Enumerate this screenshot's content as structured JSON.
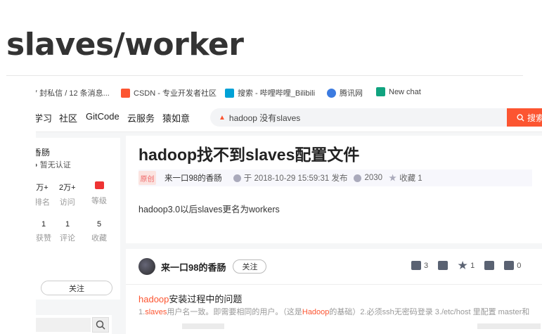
{
  "page": {
    "heading": "slaves/worker"
  },
  "browser": {
    "bookmarks": [
      {
        "label": "7 封私信 / 12 条消息...",
        "icon": "zhihu-icon",
        "color": "#1772f6"
      },
      {
        "label": "CSDN - 专业开发者社区",
        "icon": "csdn-icon",
        "color": "#fc5531"
      },
      {
        "label": "搜索 - 哔哩哔哩_Bilibili",
        "icon": "bilibili-icon",
        "color": "#00a1d6"
      },
      {
        "label": "腾讯网",
        "icon": "tencent-icon",
        "color": "#3c7be0"
      },
      {
        "label": "New chat",
        "icon": "chatgpt-icon",
        "color": "#10a37f"
      }
    ]
  },
  "nav": {
    "items": [
      "学习",
      "社区",
      "GitCode",
      "云服务",
      "猿如意"
    ],
    "search_value": "hadoop 没有slaves",
    "search_button": "搜索"
  },
  "profile": {
    "name": "香肠",
    "cert": "暂无认证",
    "stats": [
      {
        "value": "万+",
        "label": "排名"
      },
      {
        "value": "2万+",
        "label": "访问"
      },
      {
        "value": "",
        "label": "等级"
      }
    ],
    "stats2": [
      {
        "value": "1",
        "label": "获赞"
      },
      {
        "value": "1",
        "label": "评论"
      },
      {
        "value": "5",
        "label": "收藏"
      }
    ],
    "follow": "关注"
  },
  "article": {
    "title": "hadoop找不到slaves配置文件",
    "badge": "原创",
    "author": "来一口98的香肠",
    "published": "于 2018-10-29 15:59:31 发布",
    "views": "2030",
    "favorites": "收藏 1",
    "body": "hadoop3.0以后slaves更名为workers"
  },
  "footer": {
    "author": "来一口98的香肠",
    "follow": "关注",
    "likes": "3",
    "stars": "1",
    "comments": "0"
  },
  "related": {
    "title_hl": "hadoop",
    "title_rest": "安装过程中的问题",
    "desc_1": "1.",
    "desc_hl1": "slaves",
    "desc_2": "用户名一致。即需要相同的用户。（这是",
    "desc_hl2": "Hadoop",
    "desc_3": "的基础）2.必须ssh无密码登录 3./etc/host 里配置 master和"
  }
}
